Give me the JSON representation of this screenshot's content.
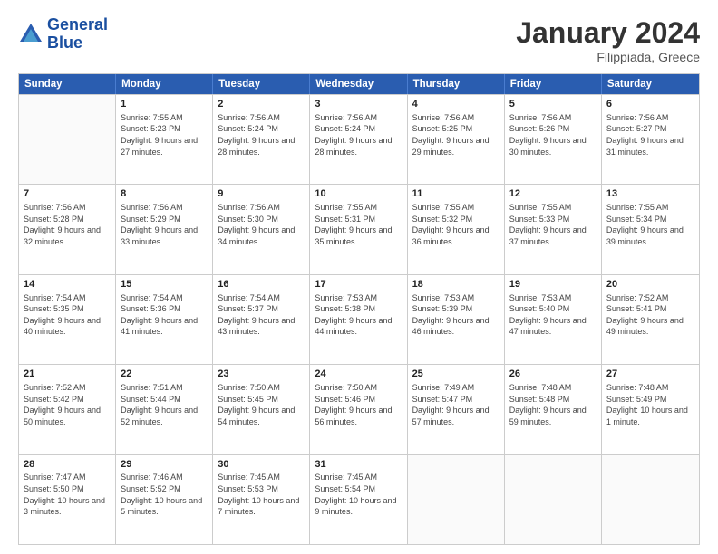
{
  "header": {
    "logo_line1": "General",
    "logo_line2": "Blue",
    "month": "January 2024",
    "location": "Filippiada, Greece"
  },
  "days_of_week": [
    "Sunday",
    "Monday",
    "Tuesday",
    "Wednesday",
    "Thursday",
    "Friday",
    "Saturday"
  ],
  "weeks": [
    [
      {
        "day": "",
        "sunrise": "",
        "sunset": "",
        "daylight": ""
      },
      {
        "day": "1",
        "sunrise": "Sunrise: 7:55 AM",
        "sunset": "Sunset: 5:23 PM",
        "daylight": "Daylight: 9 hours and 27 minutes."
      },
      {
        "day": "2",
        "sunrise": "Sunrise: 7:56 AM",
        "sunset": "Sunset: 5:24 PM",
        "daylight": "Daylight: 9 hours and 28 minutes."
      },
      {
        "day": "3",
        "sunrise": "Sunrise: 7:56 AM",
        "sunset": "Sunset: 5:24 PM",
        "daylight": "Daylight: 9 hours and 28 minutes."
      },
      {
        "day": "4",
        "sunrise": "Sunrise: 7:56 AM",
        "sunset": "Sunset: 5:25 PM",
        "daylight": "Daylight: 9 hours and 29 minutes."
      },
      {
        "day": "5",
        "sunrise": "Sunrise: 7:56 AM",
        "sunset": "Sunset: 5:26 PM",
        "daylight": "Daylight: 9 hours and 30 minutes."
      },
      {
        "day": "6",
        "sunrise": "Sunrise: 7:56 AM",
        "sunset": "Sunset: 5:27 PM",
        "daylight": "Daylight: 9 hours and 31 minutes."
      }
    ],
    [
      {
        "day": "7",
        "sunrise": "Sunrise: 7:56 AM",
        "sunset": "Sunset: 5:28 PM",
        "daylight": "Daylight: 9 hours and 32 minutes."
      },
      {
        "day": "8",
        "sunrise": "Sunrise: 7:56 AM",
        "sunset": "Sunset: 5:29 PM",
        "daylight": "Daylight: 9 hours and 33 minutes."
      },
      {
        "day": "9",
        "sunrise": "Sunrise: 7:56 AM",
        "sunset": "Sunset: 5:30 PM",
        "daylight": "Daylight: 9 hours and 34 minutes."
      },
      {
        "day": "10",
        "sunrise": "Sunrise: 7:55 AM",
        "sunset": "Sunset: 5:31 PM",
        "daylight": "Daylight: 9 hours and 35 minutes."
      },
      {
        "day": "11",
        "sunrise": "Sunrise: 7:55 AM",
        "sunset": "Sunset: 5:32 PM",
        "daylight": "Daylight: 9 hours and 36 minutes."
      },
      {
        "day": "12",
        "sunrise": "Sunrise: 7:55 AM",
        "sunset": "Sunset: 5:33 PM",
        "daylight": "Daylight: 9 hours and 37 minutes."
      },
      {
        "day": "13",
        "sunrise": "Sunrise: 7:55 AM",
        "sunset": "Sunset: 5:34 PM",
        "daylight": "Daylight: 9 hours and 39 minutes."
      }
    ],
    [
      {
        "day": "14",
        "sunrise": "Sunrise: 7:54 AM",
        "sunset": "Sunset: 5:35 PM",
        "daylight": "Daylight: 9 hours and 40 minutes."
      },
      {
        "day": "15",
        "sunrise": "Sunrise: 7:54 AM",
        "sunset": "Sunset: 5:36 PM",
        "daylight": "Daylight: 9 hours and 41 minutes."
      },
      {
        "day": "16",
        "sunrise": "Sunrise: 7:54 AM",
        "sunset": "Sunset: 5:37 PM",
        "daylight": "Daylight: 9 hours and 43 minutes."
      },
      {
        "day": "17",
        "sunrise": "Sunrise: 7:53 AM",
        "sunset": "Sunset: 5:38 PM",
        "daylight": "Daylight: 9 hours and 44 minutes."
      },
      {
        "day": "18",
        "sunrise": "Sunrise: 7:53 AM",
        "sunset": "Sunset: 5:39 PM",
        "daylight": "Daylight: 9 hours and 46 minutes."
      },
      {
        "day": "19",
        "sunrise": "Sunrise: 7:53 AM",
        "sunset": "Sunset: 5:40 PM",
        "daylight": "Daylight: 9 hours and 47 minutes."
      },
      {
        "day": "20",
        "sunrise": "Sunrise: 7:52 AM",
        "sunset": "Sunset: 5:41 PM",
        "daylight": "Daylight: 9 hours and 49 minutes."
      }
    ],
    [
      {
        "day": "21",
        "sunrise": "Sunrise: 7:52 AM",
        "sunset": "Sunset: 5:42 PM",
        "daylight": "Daylight: 9 hours and 50 minutes."
      },
      {
        "day": "22",
        "sunrise": "Sunrise: 7:51 AM",
        "sunset": "Sunset: 5:44 PM",
        "daylight": "Daylight: 9 hours and 52 minutes."
      },
      {
        "day": "23",
        "sunrise": "Sunrise: 7:50 AM",
        "sunset": "Sunset: 5:45 PM",
        "daylight": "Daylight: 9 hours and 54 minutes."
      },
      {
        "day": "24",
        "sunrise": "Sunrise: 7:50 AM",
        "sunset": "Sunset: 5:46 PM",
        "daylight": "Daylight: 9 hours and 56 minutes."
      },
      {
        "day": "25",
        "sunrise": "Sunrise: 7:49 AM",
        "sunset": "Sunset: 5:47 PM",
        "daylight": "Daylight: 9 hours and 57 minutes."
      },
      {
        "day": "26",
        "sunrise": "Sunrise: 7:48 AM",
        "sunset": "Sunset: 5:48 PM",
        "daylight": "Daylight: 9 hours and 59 minutes."
      },
      {
        "day": "27",
        "sunrise": "Sunrise: 7:48 AM",
        "sunset": "Sunset: 5:49 PM",
        "daylight": "Daylight: 10 hours and 1 minute."
      }
    ],
    [
      {
        "day": "28",
        "sunrise": "Sunrise: 7:47 AM",
        "sunset": "Sunset: 5:50 PM",
        "daylight": "Daylight: 10 hours and 3 minutes."
      },
      {
        "day": "29",
        "sunrise": "Sunrise: 7:46 AM",
        "sunset": "Sunset: 5:52 PM",
        "daylight": "Daylight: 10 hours and 5 minutes."
      },
      {
        "day": "30",
        "sunrise": "Sunrise: 7:45 AM",
        "sunset": "Sunset: 5:53 PM",
        "daylight": "Daylight: 10 hours and 7 minutes."
      },
      {
        "day": "31",
        "sunrise": "Sunrise: 7:45 AM",
        "sunset": "Sunset: 5:54 PM",
        "daylight": "Daylight: 10 hours and 9 minutes."
      },
      {
        "day": "",
        "sunrise": "",
        "sunset": "",
        "daylight": ""
      },
      {
        "day": "",
        "sunrise": "",
        "sunset": "",
        "daylight": ""
      },
      {
        "day": "",
        "sunrise": "",
        "sunset": "",
        "daylight": ""
      }
    ]
  ]
}
